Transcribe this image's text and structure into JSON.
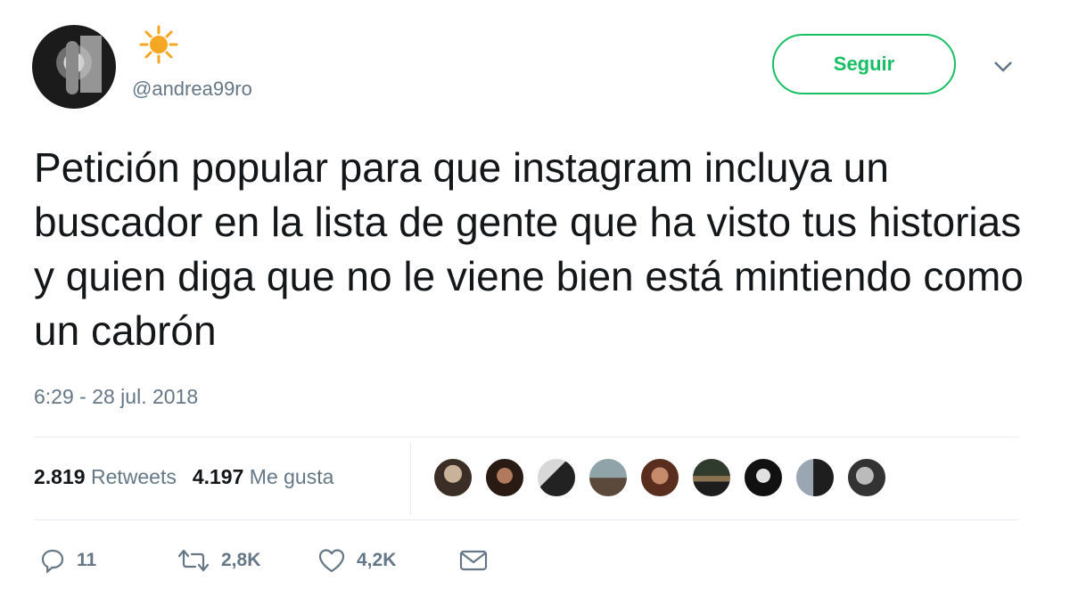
{
  "user": {
    "handle": "@andrea99ro",
    "badge_icon": "star-icon",
    "badge_color": "#f5a623"
  },
  "header": {
    "follow_label": "Seguir",
    "menu_icon": "chevron-down-icon",
    "accent_color": "#17bf63"
  },
  "tweet": {
    "text": "Petición popular para que instagram incluya un buscador en la lista de gente que ha visto tus historias y quien diga que no le viene bien está mintiendo como un cabrón",
    "timestamp": "6:29 - 28 jul. 2018"
  },
  "stats": {
    "retweets_count": "2.819",
    "retweets_label": "Retweets",
    "likes_count": "4.197",
    "likes_label": "Me gusta",
    "liker_avatar_count": 9
  },
  "actions": {
    "reply_count": "11",
    "retweet_count": "2,8K",
    "like_count": "4,2K",
    "icons": [
      "reply-icon",
      "retweet-icon",
      "heart-icon",
      "message-icon"
    ]
  }
}
